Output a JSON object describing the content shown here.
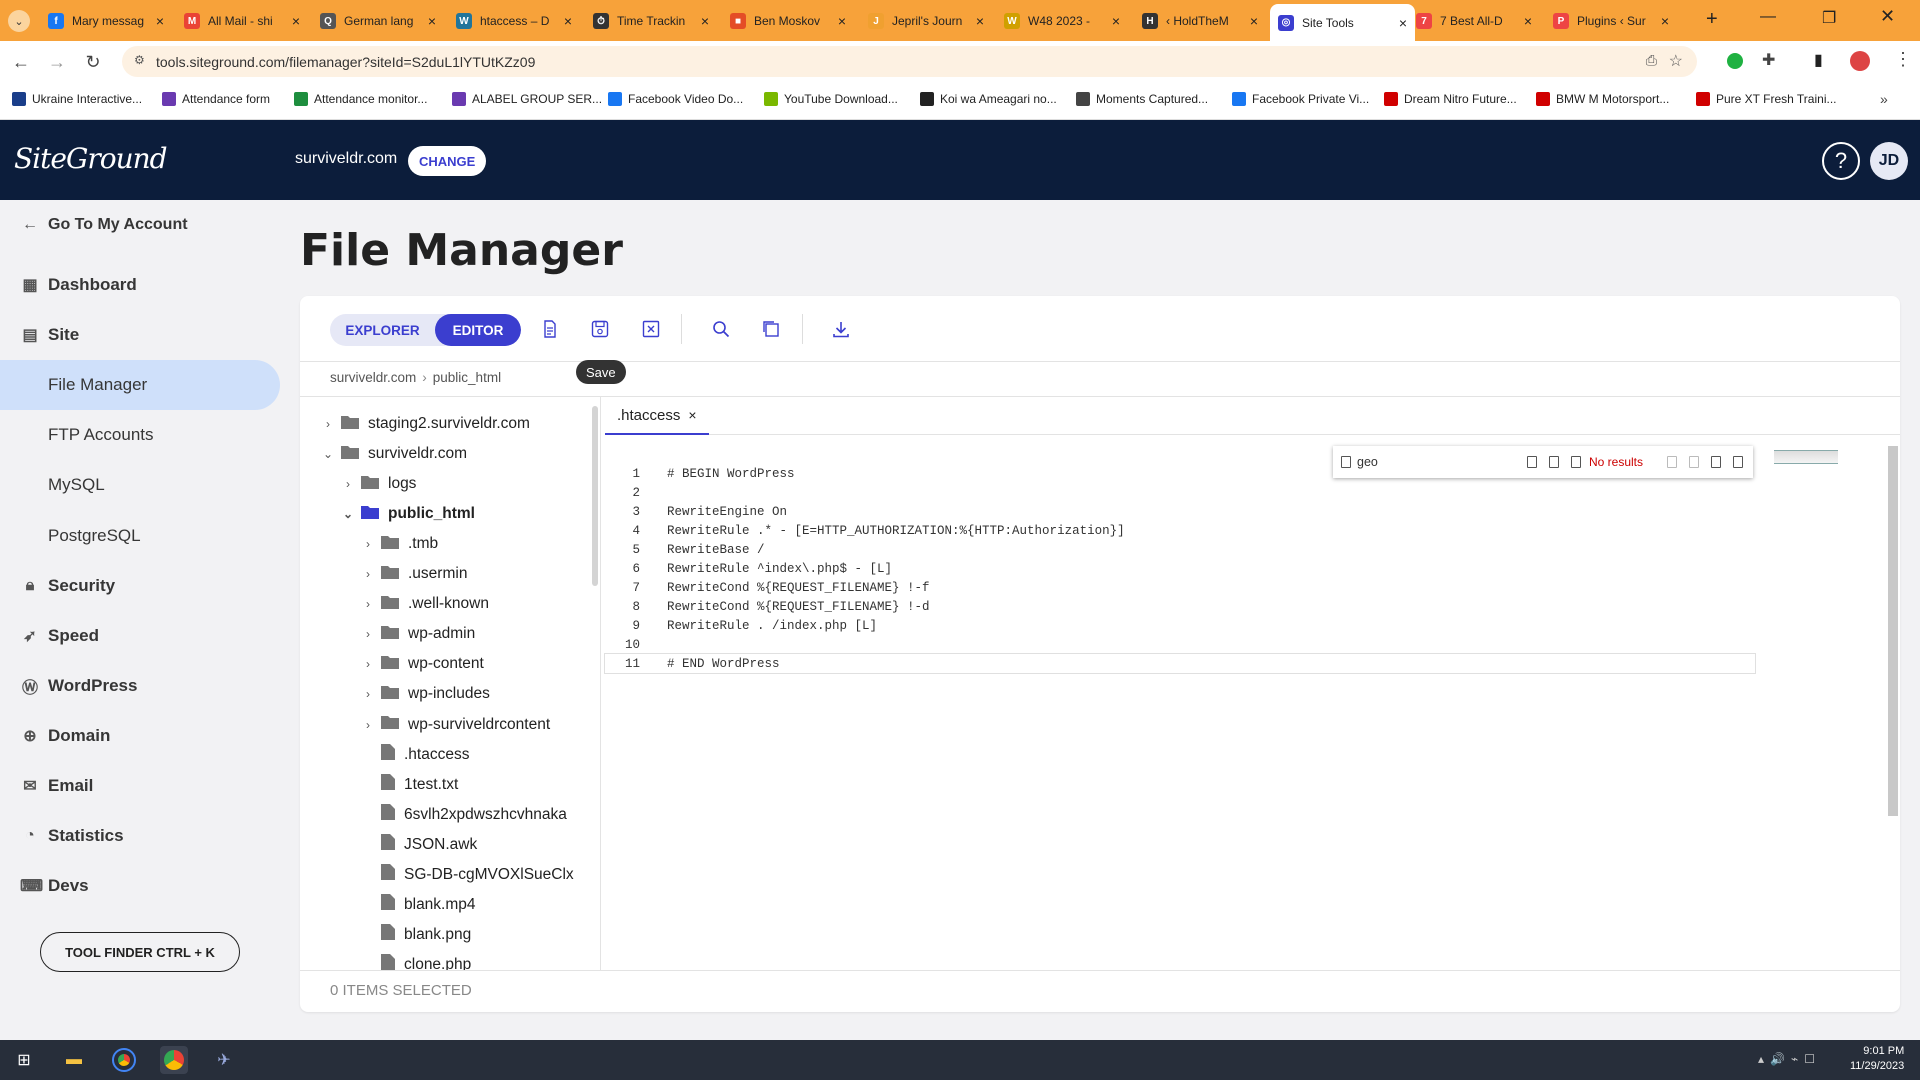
{
  "browser": {
    "tabs": [
      {
        "title": "Mary messag",
        "color": "#1877f2",
        "glyph": "f"
      },
      {
        "title": "All Mail - shi",
        "color": "#ea4335",
        "glyph": "M"
      },
      {
        "title": "German lang",
        "color": "#555555",
        "glyph": "Q"
      },
      {
        "title": "htaccess – D",
        "color": "#21759b",
        "glyph": "W"
      },
      {
        "title": "Time Trackin",
        "color": "#333333",
        "glyph": "⏱"
      },
      {
        "title": "Ben Moskov",
        "color": "#e44d26",
        "glyph": "■"
      },
      {
        "title": "Jepril's Journ",
        "color": "#f0a030",
        "glyph": "J"
      },
      {
        "title": "W48 2023 -",
        "color": "#d0a000",
        "glyph": "W"
      },
      {
        "title": "‹ HoldTheM",
        "color": "#333333",
        "glyph": "H"
      },
      {
        "title": "Site Tools",
        "color": "#3b3ecf",
        "glyph": "◎"
      },
      {
        "title": "7 Best All-D",
        "color": "#e44",
        "glyph": "7"
      },
      {
        "title": "Plugins ‹ Sur",
        "color": "#e44",
        "glyph": "P"
      }
    ],
    "active_tab_index": 9,
    "url": "tools.siteground.com/filemanager?siteId=S2duL1lYTUtKZz09",
    "bookmarks": [
      {
        "label": "Ukraine Interactive...",
        "color": "#1a3e8a"
      },
      {
        "label": "Attendance form",
        "color": "#6a3ab0"
      },
      {
        "label": "Attendance monitor...",
        "color": "#1e8e3e"
      },
      {
        "label": "ALABEL GROUP SER...",
        "color": "#6a3ab0"
      },
      {
        "label": "Facebook Video Do...",
        "color": "#1877f2"
      },
      {
        "label": "YouTube Download...",
        "color": "#7ab800"
      },
      {
        "label": "Koi wa Ameagari no...",
        "color": "#222222"
      },
      {
        "label": "Moments Captured...",
        "color": "#444444"
      },
      {
        "label": "Facebook Private Vi...",
        "color": "#1877f2"
      },
      {
        "label": "Dream Nitro Future...",
        "color": "#d00000"
      },
      {
        "label": "BMW M Motorsport...",
        "color": "#d00000"
      },
      {
        "label": "Pure XT Fresh Traini...",
        "color": "#d00000"
      }
    ]
  },
  "header": {
    "logo": "SiteGround",
    "domain": "surviveldr.com",
    "change_label": "CHANGE",
    "help_label": "?",
    "avatar_initials": "JD"
  },
  "sidebar": {
    "back_label": "Go To My Account",
    "items": [
      {
        "label": "Dashboard",
        "icon": "grid-icon",
        "type": "main"
      },
      {
        "label": "Site",
        "icon": "site-icon",
        "type": "main"
      },
      {
        "label": "File Manager",
        "type": "sub",
        "active": true
      },
      {
        "label": "FTP Accounts",
        "type": "sub"
      },
      {
        "label": "MySQL",
        "type": "sub"
      },
      {
        "label": "PostgreSQL",
        "type": "sub"
      },
      {
        "label": "Security",
        "icon": "lock-icon",
        "type": "main"
      },
      {
        "label": "Speed",
        "icon": "rocket-icon",
        "type": "main"
      },
      {
        "label": "WordPress",
        "icon": "wordpress-icon",
        "type": "main"
      },
      {
        "label": "Domain",
        "icon": "globe-icon",
        "type": "main"
      },
      {
        "label": "Email",
        "icon": "mail-icon",
        "type": "main"
      },
      {
        "label": "Statistics",
        "icon": "chart-icon",
        "type": "main"
      },
      {
        "label": "Devs",
        "icon": "code-icon",
        "type": "main"
      }
    ],
    "tool_finder_label": "TOOL FINDER CTRL + K"
  },
  "main": {
    "title": "File Manager",
    "mode_explorer": "EXPLORER",
    "mode_editor": "EDITOR",
    "tooltip": "Save",
    "breadcrumb": [
      "surviveldr.com",
      "public_html"
    ],
    "tree": [
      {
        "name": "staging2.surviveldr.com",
        "type": "folder",
        "depth": 0,
        "expanded": false
      },
      {
        "name": "surviveldr.com",
        "type": "folder",
        "depth": 0,
        "expanded": true
      },
      {
        "name": "logs",
        "type": "folder",
        "depth": 1,
        "expanded": false
      },
      {
        "name": "public_html",
        "type": "folder",
        "depth": 1,
        "expanded": true,
        "selected": true
      },
      {
        "name": ".tmb",
        "type": "folder",
        "depth": 2,
        "expanded": false
      },
      {
        "name": ".usermin",
        "type": "folder",
        "depth": 2,
        "expanded": false
      },
      {
        "name": ".well-known",
        "type": "folder",
        "depth": 2,
        "expanded": false
      },
      {
        "name": "wp-admin",
        "type": "folder",
        "depth": 2,
        "expanded": false
      },
      {
        "name": "wp-content",
        "type": "folder",
        "depth": 2,
        "expanded": false
      },
      {
        "name": "wp-includes",
        "type": "folder",
        "depth": 2,
        "expanded": false
      },
      {
        "name": "wp-surviveldrcontent",
        "type": "folder",
        "depth": 2,
        "expanded": false
      },
      {
        "name": ".htaccess",
        "type": "file",
        "depth": 2
      },
      {
        "name": "1test.txt",
        "type": "file",
        "depth": 2
      },
      {
        "name": "6svlh2xpdwszhcvhnaka",
        "type": "file",
        "depth": 2
      },
      {
        "name": "JSON.awk",
        "type": "file",
        "depth": 2
      },
      {
        "name": "SG-DB-cgMVOXlSueClx",
        "type": "file",
        "depth": 2
      },
      {
        "name": "blank.mp4",
        "type": "file",
        "depth": 2
      },
      {
        "name": "blank.png",
        "type": "file",
        "depth": 2
      },
      {
        "name": "clone.php",
        "type": "file",
        "depth": 2
      }
    ],
    "editor_tab": ".htaccess",
    "editor_tab_close": "×",
    "code_lines": [
      "# BEGIN WordPress",
      "",
      "RewriteEngine On",
      "RewriteRule .* - [E=HTTP_AUTHORIZATION:%{HTTP:Authorization}]",
      "RewriteBase /",
      "RewriteRule ^index\\.php$ - [L]",
      "RewriteCond %{REQUEST_FILENAME} !-f",
      "RewriteCond %{REQUEST_FILENAME} !-d",
      "RewriteRule . /index.php [L]",
      "",
      "# END WordPress"
    ],
    "current_line": 11,
    "find": {
      "query": "geo",
      "status": "No results"
    },
    "items_selected": "0 ITEMS SELECTED"
  },
  "taskbar": {
    "time": "9:01 PM",
    "date": "11/29/2023"
  },
  "colors": {
    "accent": "#3b3ecf",
    "header": "#0c1d3b",
    "tabbar": "#f7a23a",
    "active_nav": "#cfe0fa"
  }
}
